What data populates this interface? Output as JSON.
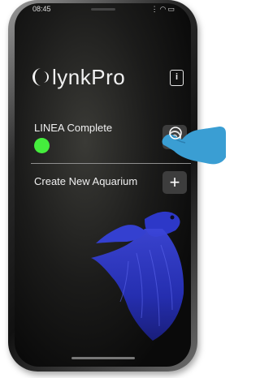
{
  "app": {
    "brand_name": "lynkPro"
  },
  "status_bar": {
    "time": "08:45",
    "icons": [
      "signal-icon",
      "wifi-icon",
      "battery-icon"
    ]
  },
  "header": {
    "info_icon_glyph": "i"
  },
  "aquarium": {
    "name": "LINEA Complete",
    "status_color": "#45ee3d"
  },
  "create": {
    "label": "Create New Aquarium",
    "button_glyph": "+"
  },
  "colors": {
    "background": "#0a0a0a",
    "button_bg": "#3d3d3d",
    "text": "#f0f0f0",
    "hand": "#3a9ed3"
  }
}
